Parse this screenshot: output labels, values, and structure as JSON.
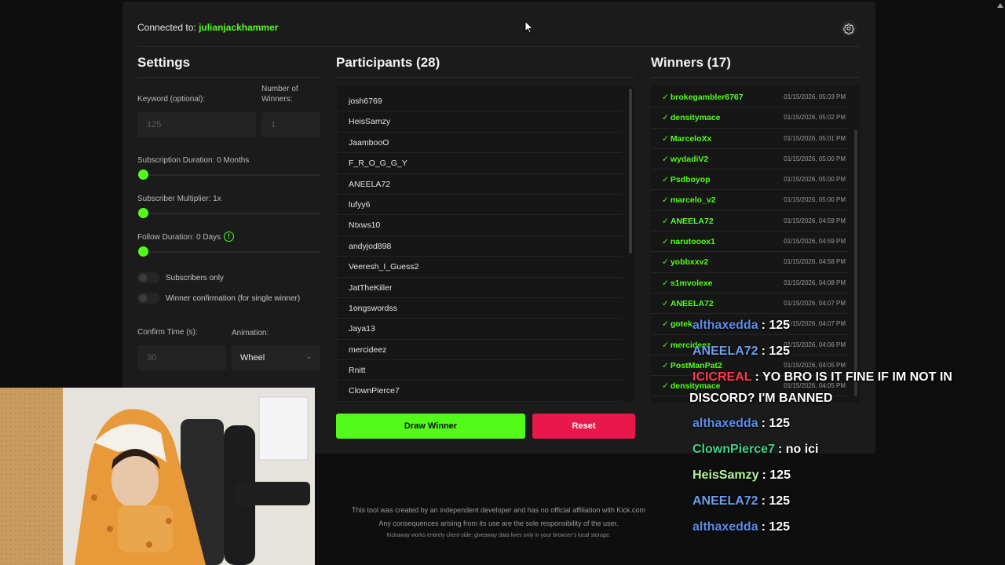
{
  "header": {
    "connected_label": "Connected to:",
    "channel": "julianjackhammer",
    "settings_icon": "gear-icon"
  },
  "settings": {
    "title": "Settings",
    "keyword_label": "Keyword (optional):",
    "keyword_placeholder": "125",
    "winners_label": "Number of Winners:",
    "winners_placeholder": "1",
    "sub_duration_label": "Subscription Duration: 0 Months",
    "sub_multiplier_label": "Subscriber Multiplier: 1x",
    "follow_duration_label": "Follow Duration: 0 Days",
    "subscribers_only_label": "Subscribers only",
    "winner_confirmation_label": "Winner confirmation (for single winner)",
    "confirm_time_label": "Confirm Time (s):",
    "confirm_time_placeholder": "30",
    "animation_label": "Animation:",
    "animation_value": "Wheel"
  },
  "participants": {
    "title": "Participants (28)",
    "items": [
      "josh6769",
      "HeisSamzy",
      "JaambooO",
      "F_R_O_G_G_Y",
      "ANEELA72",
      "lufyy6",
      "Ntxws10",
      "andyjod898",
      "Veeresh_I_Guess2",
      "JatTheKiller",
      "1ongswordss",
      "Jaya13",
      "mercideez",
      "Rnitt",
      "ClownPierce7"
    ]
  },
  "winners": {
    "title": "Winners (17)",
    "items": [
      {
        "name": "brokegambler6767",
        "time": "01/15/2026, 05:03 PM"
      },
      {
        "name": "densitymace",
        "time": "01/15/2026, 05:02 PM"
      },
      {
        "name": "MarceloXx",
        "time": "01/15/2026, 05:01 PM"
      },
      {
        "name": "wydadiV2",
        "time": "01/15/2026, 05:00 PM"
      },
      {
        "name": "Psdboyop",
        "time": "01/15/2026, 05:00 PM"
      },
      {
        "name": "marcelo_v2",
        "time": "01/15/2026, 05:00 PM"
      },
      {
        "name": "ANEELA72",
        "time": "01/15/2026, 04:59 PM"
      },
      {
        "name": "narutooox1",
        "time": "01/15/2026, 04:59 PM"
      },
      {
        "name": "yobbxxv2",
        "time": "01/15/2026, 04:58 PM"
      },
      {
        "name": "s1mvolexe",
        "time": "01/15/2026, 04:08 PM"
      },
      {
        "name": "ANEELA72",
        "time": "01/15/2026, 04:07 PM"
      },
      {
        "name": "gotek",
        "time": "01/15/2026, 04:07 PM"
      },
      {
        "name": "mercideez",
        "time": "01/15/2026, 04:06 PM"
      },
      {
        "name": "PostManPat2",
        "time": "01/15/2026, 04:05 PM"
      },
      {
        "name": "densitymace",
        "time": "01/15/2026, 04:05 PM"
      }
    ]
  },
  "actions": {
    "draw_label": "Draw Winner",
    "reset_label": "Reset"
  },
  "footer": {
    "line1": "This tool was created by an independent developer and has no official affiliation with Kick.com",
    "line2": "Any consequences arising from its use are the sole responsibility of the user.",
    "line3": "Kickaway works entirely client-side; giveaway data lives only in your browser's local storage."
  },
  "chat_overlay": {
    "messages": [
      {
        "user": "althaxedda",
        "color": "#5b8ee8",
        "text": ": 125"
      },
      {
        "user": "ANEELA72",
        "color": "#6aa0ee",
        "text": ": 125"
      },
      {
        "user": "ICICREAL",
        "color": "#ff3b4d",
        "text": ": YO BRO IS IT FINE IF IM NOT IN"
      },
      {
        "user": "",
        "color": "#ffffff",
        "text": "DISCORD? I'M BANNED"
      },
      {
        "user": "althaxedda",
        "color": "#5b8ee8",
        "text": ": 125"
      },
      {
        "user": "ClownPierce7",
        "color": "#3fd58a",
        "text": ": no ici"
      },
      {
        "user": "HeisSamzy",
        "color": "#b2f59a",
        "text": ": 125"
      },
      {
        "user": "ANEELA72",
        "color": "#6aa0ee",
        "text": ": 125"
      },
      {
        "user": "althaxedda",
        "color": "#5b8ee8",
        "text": ": 125"
      }
    ]
  },
  "colors": {
    "accent": "#53fc18",
    "danger": "#e9174a",
    "panel": "#1b1b1b"
  }
}
